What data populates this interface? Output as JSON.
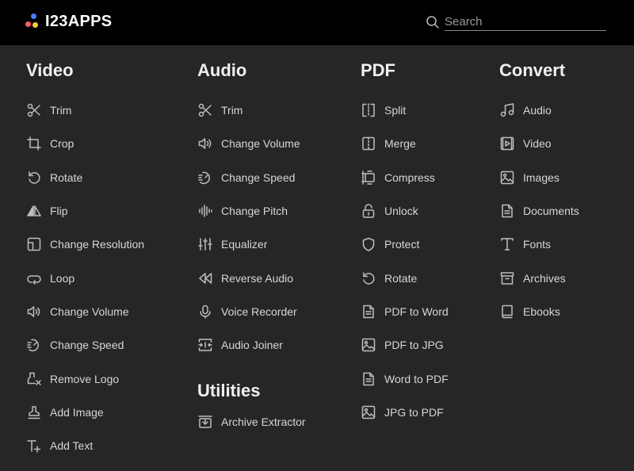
{
  "header": {
    "logo_text": "I23APPS",
    "logo_dot_colors": [
      "#4f7cff",
      "#ff5b5b",
      "#ffc83d"
    ],
    "search": {
      "placeholder": "Search",
      "value": ""
    }
  },
  "columns": {
    "video": {
      "title": "Video",
      "items": [
        {
          "label": "Trim",
          "icon": "scissors-icon"
        },
        {
          "label": "Crop",
          "icon": "crop-icon"
        },
        {
          "label": "Rotate",
          "icon": "rotate-icon"
        },
        {
          "label": "Flip",
          "icon": "flip-icon"
        },
        {
          "label": "Change Resolution",
          "icon": "resolution-icon"
        },
        {
          "label": "Loop",
          "icon": "loop-icon"
        },
        {
          "label": "Change Volume",
          "icon": "volume-icon"
        },
        {
          "label": "Change Speed",
          "icon": "speed-icon"
        },
        {
          "label": "Remove Logo",
          "icon": "remove-logo-icon"
        },
        {
          "label": "Add Image",
          "icon": "stamp-icon"
        },
        {
          "label": "Add Text",
          "icon": "add-text-icon"
        }
      ]
    },
    "audio": {
      "title": "Audio",
      "items": [
        {
          "label": "Trim",
          "icon": "scissors-icon"
        },
        {
          "label": "Change Volume",
          "icon": "volume-icon"
        },
        {
          "label": "Change Speed",
          "icon": "speed-icon"
        },
        {
          "label": "Change Pitch",
          "icon": "pitch-icon"
        },
        {
          "label": "Equalizer",
          "icon": "equalizer-icon"
        },
        {
          "label": "Reverse Audio",
          "icon": "reverse-icon"
        },
        {
          "label": "Voice Recorder",
          "icon": "microphone-icon"
        },
        {
          "label": "Audio Joiner",
          "icon": "joiner-icon"
        }
      ]
    },
    "utilities": {
      "title": "Utilities",
      "items": [
        {
          "label": "Archive Extractor",
          "icon": "archive-extract-icon"
        }
      ]
    },
    "pdf": {
      "title": "PDF",
      "items": [
        {
          "label": "Split",
          "icon": "split-icon"
        },
        {
          "label": "Merge",
          "icon": "merge-icon"
        },
        {
          "label": "Compress",
          "icon": "compress-icon"
        },
        {
          "label": "Unlock",
          "icon": "unlock-icon"
        },
        {
          "label": "Protect",
          "icon": "shield-icon"
        },
        {
          "label": "Rotate",
          "icon": "rotate-icon"
        },
        {
          "label": "PDF to Word",
          "icon": "document-icon"
        },
        {
          "label": "PDF to JPG",
          "icon": "image-icon"
        },
        {
          "label": "Word to PDF",
          "icon": "document-icon"
        },
        {
          "label": "JPG to PDF",
          "icon": "image-icon"
        }
      ]
    },
    "convert": {
      "title": "Convert",
      "items": [
        {
          "label": "Audio",
          "icon": "music-note-icon"
        },
        {
          "label": "Video",
          "icon": "video-icon"
        },
        {
          "label": "Images",
          "icon": "image-icon"
        },
        {
          "label": "Documents",
          "icon": "document-icon"
        },
        {
          "label": "Fonts",
          "icon": "font-icon"
        },
        {
          "label": "Archives",
          "icon": "archive-icon"
        },
        {
          "label": "Ebooks",
          "icon": "book-icon"
        }
      ]
    }
  }
}
